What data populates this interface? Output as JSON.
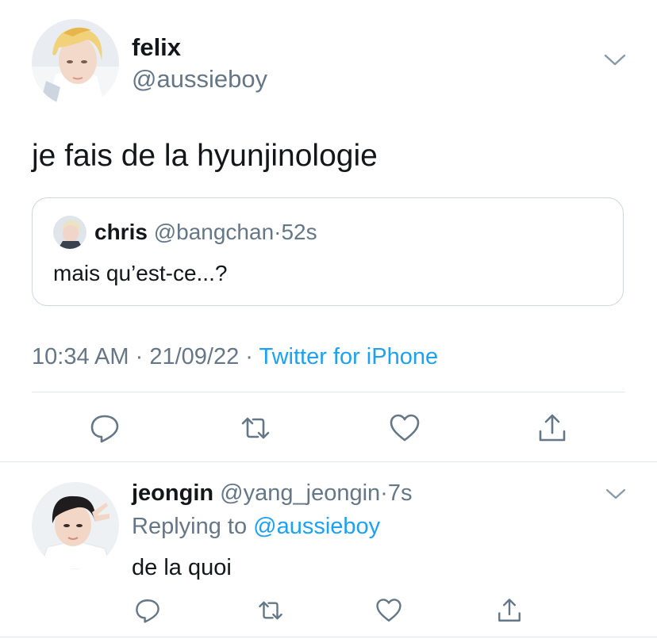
{
  "main_tweet": {
    "display_name": "felix",
    "handle": "@aussieboy",
    "text": "je fais de la hyunjinologie",
    "quoted": {
      "display_name": "chris",
      "handle": "@bangchan",
      "separator": "·",
      "age": "52s",
      "text": "mais qu’est-ce...?"
    },
    "time": "10:34 AM",
    "sep1": " · ",
    "date": "21/09/22",
    "sep2": " · ",
    "source": "Twitter for iPhone",
    "actions": [
      "reply-icon",
      "retweet-icon",
      "like-icon",
      "share-icon"
    ]
  },
  "reply_tweet": {
    "display_name": "jeongin",
    "handle": "@yang_jeongin",
    "separator": "·",
    "age": "7s",
    "replying_prefix": "Replying to ",
    "replying_handle": "@aussieboy",
    "text": "de la quoi",
    "actions": [
      "reply-icon",
      "retweet-icon",
      "like-icon",
      "share-icon"
    ]
  },
  "colors": {
    "primary_text": "#14171a",
    "secondary_text": "#657786",
    "link": "#1da1f2",
    "divider": "#e1e8ed",
    "icon": "#657786"
  }
}
